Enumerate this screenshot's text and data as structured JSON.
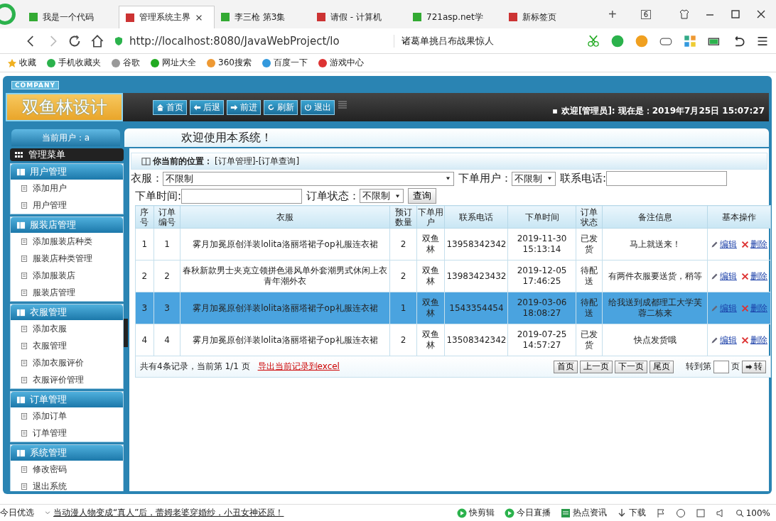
{
  "browser": {
    "tabs": [
      {
        "label": "我是一个代码",
        "selected": false
      },
      {
        "label": "管理系统主界",
        "selected": true
      },
      {
        "label": "李三枪 第3集",
        "selected": false
      },
      {
        "label": "请假 - 计算机",
        "selected": false
      },
      {
        "label": "721asp.net学",
        "selected": false
      },
      {
        "label": "新标签页",
        "selected": false
      }
    ],
    "new_tab": "+",
    "tab_count": "6",
    "url": "http://localhost:8080/JavaWebProject/lo",
    "search_text": "诸葛单挑吕布战果惊人",
    "bookmarks": [
      "收藏",
      "手机收藏夹",
      "谷歌",
      "网址大全",
      "360搜索",
      "百度一下",
      "游戏中心"
    ]
  },
  "header": {
    "company": "COMPANY",
    "logo": "双鱼林设计",
    "nav": [
      "首页",
      "后退",
      "前进",
      "刷新",
      "退出"
    ],
    "welcome": "欢迎[管理员]:",
    "now": "现在是：2019年7月25日 15:07:27"
  },
  "user_label": "当前用户：a",
  "banner": "欢迎使用本系统！",
  "sidebar": {
    "title": "管理菜单",
    "groups": [
      {
        "title": "用户管理",
        "items": [
          "添加用户",
          "用户管理"
        ]
      },
      {
        "title": "服装店管理",
        "items": [
          "添加服装店种类",
          "服装店种类管理",
          "添加服装店",
          "服装店管理"
        ]
      },
      {
        "title": "衣服管理",
        "items": [
          "添加衣服",
          "衣服管理",
          "添加衣服评价",
          "衣服评价管理"
        ]
      },
      {
        "title": "订单管理",
        "items": [
          "添加订单",
          "订单管理"
        ]
      },
      {
        "title": "系统管理",
        "items": [
          "修改密码",
          "退出系统"
        ]
      }
    ]
  },
  "breadcrumb": {
    "label": "你当前的位置：",
    "path": "[订单管理]-[订单查询]"
  },
  "search": {
    "fields": [
      {
        "kind": "select",
        "label": "衣服：",
        "value": "不限制"
      },
      {
        "kind": "select",
        "label": "下单用户：",
        "value": "不限制"
      },
      {
        "kind": "input",
        "label": "联系电话:"
      },
      {
        "kind": "input",
        "label": "下单时间:"
      },
      {
        "kind": "select",
        "label": "订单状态：",
        "value": "不限制"
      }
    ],
    "button": "查询"
  },
  "table": {
    "columns": [
      "序号",
      "订单编号",
      "衣服",
      "预订数量",
      "下单用户",
      "联系电话",
      "下单时间",
      "订单状态",
      "备注信息",
      "基本操作"
    ],
    "rows": [
      {
        "selected": false,
        "cells": [
          "1",
          "1",
          "雾月加冕原创洋装lolita洛丽塔裙子op礼服连衣裙",
          "2",
          "双鱼林",
          "13958342342",
          "2019-11-30 15:13:14",
          "已发货",
          "马上就送来！"
        ],
        "actions": [
          "编辑",
          "删除"
        ]
      },
      {
        "selected": false,
        "cells": [
          "2",
          "2",
          "春秋新款男士夹克立领拼色港风单外套潮男式休闲上衣青年潮外衣",
          "2",
          "双鱼林",
          "13983423432",
          "2019-12-05 17:46:25",
          "待配送",
          "有两件衣服要送货，稍等"
        ],
        "actions": [
          "编辑",
          "删除"
        ]
      },
      {
        "selected": true,
        "cells": [
          "3",
          "3",
          "雾月加冕原创洋装lolita洛丽塔裙子op礼服连衣裙",
          "1",
          "双鱼林",
          "1543354454",
          "2019-03-06 18:08:27",
          "待配送",
          "给我送到成都理工大学芙蓉二栋来"
        ],
        "actions": [
          "编辑",
          "删除"
        ]
      },
      {
        "selected": false,
        "cells": [
          "4",
          "4",
          "雾月加冕原创洋装lolita洛丽塔裙子op礼服连衣裙",
          "2",
          "双鱼林",
          "13508342342",
          "2019-07-25 14:57:27",
          "已发货",
          "快点发货哦"
        ],
        "actions": [
          "编辑",
          "删除"
        ]
      }
    ]
  },
  "pager": {
    "summary": "共有4条记录，当前第 1/1 页",
    "export_link": "导出当前记录到excel",
    "buttons": [
      "首页",
      "上一页",
      "下一页",
      "尾页"
    ],
    "goto_label": "转到第",
    "page_label": "页",
    "go_button": "转"
  },
  "status_bar": {
    "left": "今日优选",
    "news": "当动漫人物变成“真人”后，蕾姆老婆穿婚纱，小丑女神还原！",
    "items": [
      "快剪辑",
      "今日直播",
      "热点资讯",
      "下载"
    ],
    "zoom": "100%"
  }
}
